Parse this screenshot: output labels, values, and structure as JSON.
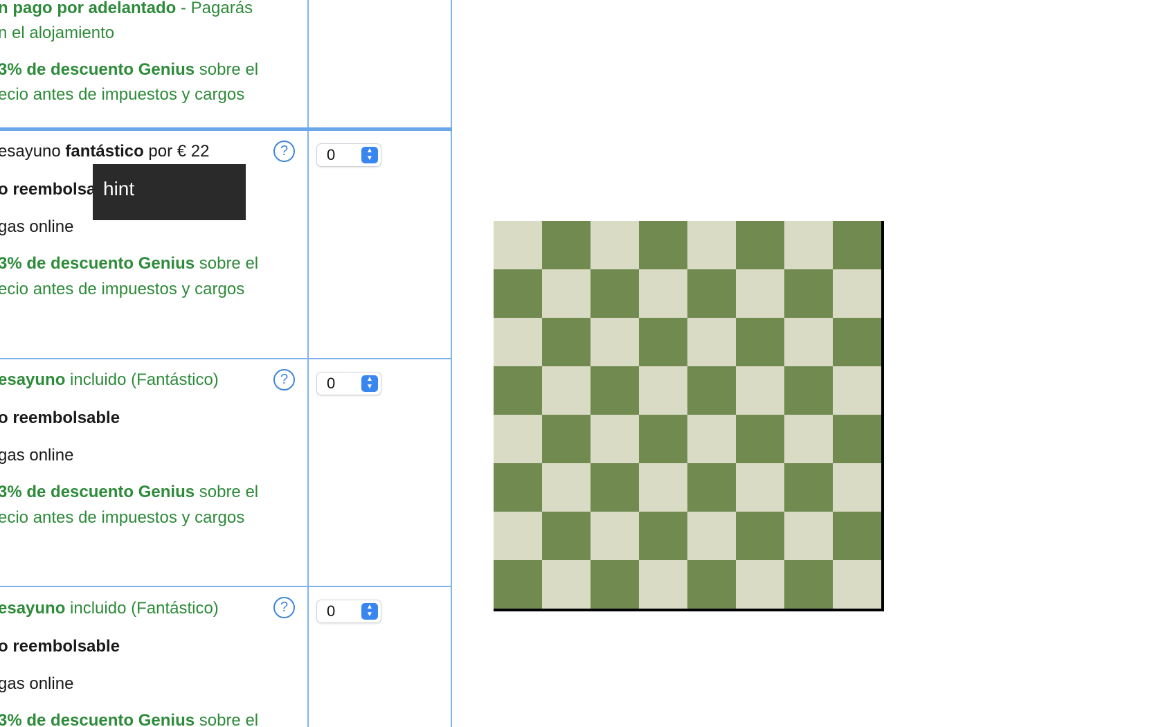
{
  "rows": [
    {
      "lines": [
        [
          {
            "t": "n pago por adelantado",
            "b": true,
            "g": true
          },
          {
            "t": " - Pagarás",
            "g": true
          }
        ],
        [
          {
            "t": "n el alojamiento",
            "g": true
          }
        ],
        [
          {
            "t": "3% de descuento Genius",
            "b": true,
            "g": true
          },
          {
            "t": " sobre el",
            "g": true
          }
        ],
        [
          {
            "t": "ecio antes de impuestos y cargos",
            "g": true
          }
        ]
      ]
    },
    {
      "help": "?",
      "select": "0",
      "lines": [
        [
          {
            "t": "esayuno "
          },
          {
            "t": "fantástico",
            "b": true
          },
          {
            "t": " por € 22"
          }
        ],
        [
          {
            "t": "o reembolsa",
            "b": true
          }
        ],
        [
          {
            "t": "gas online"
          }
        ],
        [
          {
            "t": "3% de descuento Genius",
            "b": true,
            "g": true
          },
          {
            "t": " sobre el",
            "g": true
          }
        ],
        [
          {
            "t": "ecio antes de impuestos y cargos",
            "g": true
          }
        ]
      ]
    },
    {
      "help": "?",
      "select": "0",
      "lines": [
        [
          {
            "t": "esayuno",
            "b": true,
            "g": true
          },
          {
            "t": " incluido (Fantástico)",
            "g": true
          }
        ],
        [
          {
            "t": "o reembolsable",
            "b": true
          }
        ],
        [
          {
            "t": "gas online"
          }
        ],
        [
          {
            "t": "3% de descuento Genius",
            "b": true,
            "g": true
          },
          {
            "t": " sobre el",
            "g": true
          }
        ],
        [
          {
            "t": "ecio antes de impuestos y cargos",
            "g": true
          }
        ]
      ]
    },
    {
      "help": "?",
      "select": "0",
      "lines": [
        [
          {
            "t": "esayuno",
            "b": true,
            "g": true
          },
          {
            "t": " incluido (Fantástico)",
            "g": true
          }
        ],
        [
          {
            "t": "o reembolsable",
            "b": true
          }
        ],
        [
          {
            "t": "gas online"
          }
        ],
        [
          {
            "t": "3% de descuento Genius",
            "b": true,
            "g": true
          },
          {
            "t": " sobre el",
            "g": true
          }
        ]
      ]
    }
  ],
  "tooltip": {
    "text": "hint"
  },
  "colors": {
    "accent_green": "#2e8b3a",
    "table_border": "#7fb3ea",
    "select_arrow": "#3a86f0",
    "board_light": "#dadbc4",
    "board_dark": "#708a50"
  },
  "board": {
    "size": 8,
    "first_square": "light"
  }
}
